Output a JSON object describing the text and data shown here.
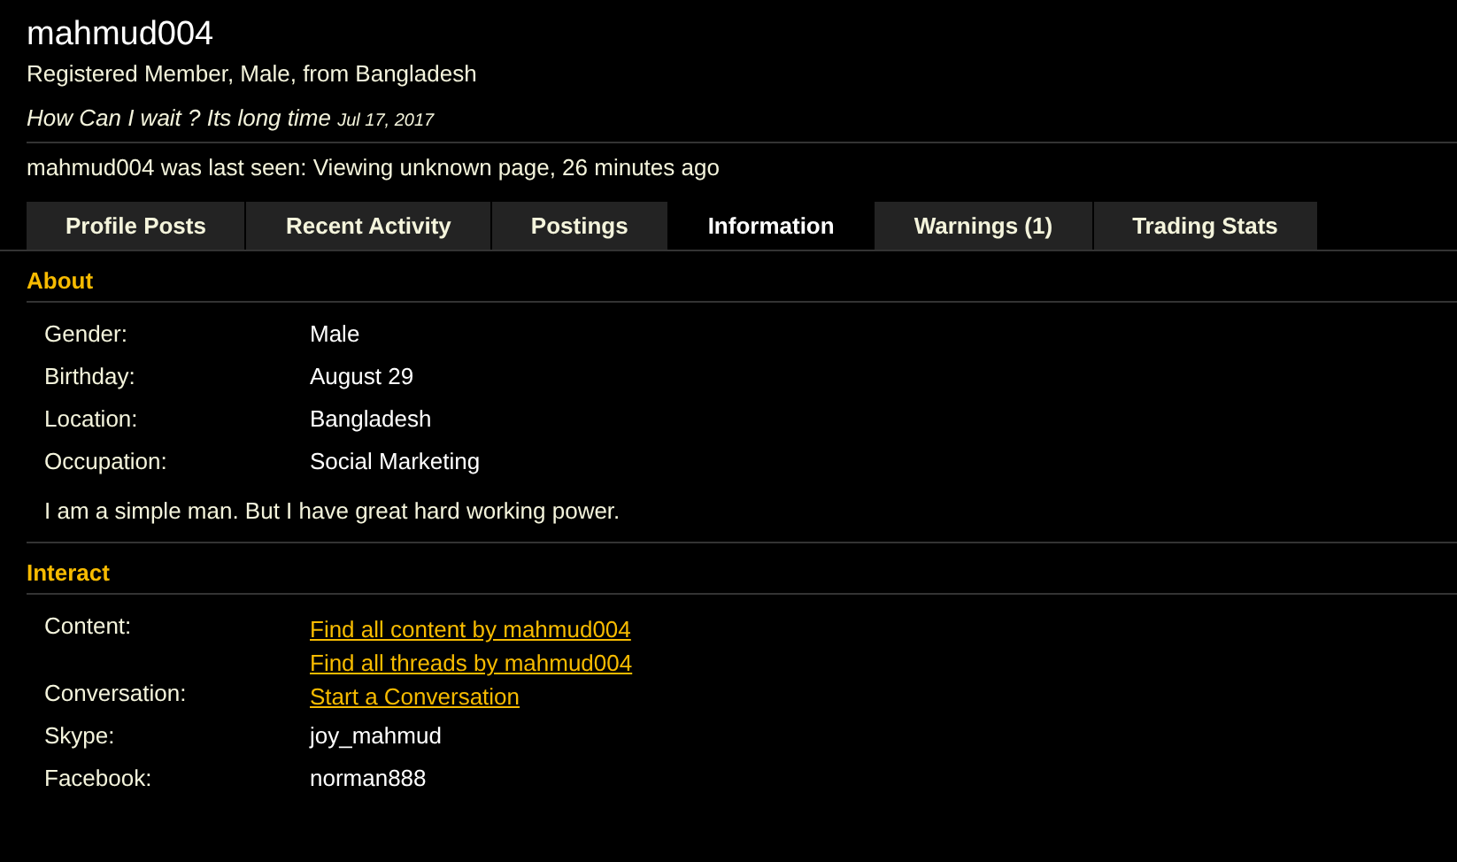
{
  "profile": {
    "username": "mahmud004",
    "subtitle": "Registered Member, Male, from Bangladesh",
    "status": "How Can I wait ? Its long time",
    "status_date": "Jul 17, 2017",
    "last_seen": "mahmud004 was last seen: Viewing unknown page, 26 minutes ago"
  },
  "tabs": [
    {
      "label": "Profile Posts",
      "selected": false
    },
    {
      "label": "Recent Activity",
      "selected": false
    },
    {
      "label": "Postings",
      "selected": false
    },
    {
      "label": "Information",
      "selected": true
    },
    {
      "label": "Warnings (1)",
      "selected": false
    },
    {
      "label": "Trading Stats",
      "selected": false
    }
  ],
  "about": {
    "heading": "About",
    "fields": [
      {
        "label": "Gender:",
        "value": "Male"
      },
      {
        "label": "Birthday:",
        "value": "August 29"
      },
      {
        "label": "Location:",
        "value": "Bangladesh"
      },
      {
        "label": "Occupation:",
        "value": "Social Marketing"
      }
    ],
    "bio": "I am a simple man. But I have great hard working power."
  },
  "interact": {
    "heading": "Interact",
    "fields": [
      {
        "label": "Content:",
        "values": [
          {
            "kind": "link",
            "text": "Find all content by mahmud004"
          },
          {
            "kind": "link",
            "text": "Find all threads by mahmud004"
          }
        ]
      },
      {
        "label": "Conversation:",
        "values": [
          {
            "kind": "link",
            "text": "Start a Conversation"
          }
        ]
      },
      {
        "label": "Skype:",
        "values": [
          {
            "kind": "text",
            "text": "joy_mahmud"
          }
        ]
      },
      {
        "label": "Facebook:",
        "values": [
          {
            "kind": "text",
            "text": "norman888"
          }
        ]
      }
    ]
  }
}
